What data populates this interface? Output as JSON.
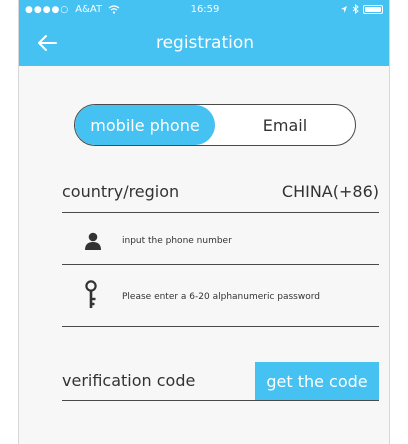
{
  "status_bar": {
    "signal_dots": "●●●●○",
    "carrier": "A&AT",
    "time": "16:59"
  },
  "nav": {
    "title": "registration"
  },
  "segment": {
    "active": "mobile phone",
    "inactive": "Email"
  },
  "country": {
    "label": "country/region",
    "value": "CHINA(+86)"
  },
  "phone": {
    "placeholder": "input the phone number"
  },
  "password": {
    "placeholder": "Please enter a 6-20 alphanumeric password"
  },
  "verification": {
    "label": "verification code",
    "button": "get the code"
  },
  "colors": {
    "accent": "#45c1f2",
    "line": "#4a4a4a",
    "background": "#f7f7f7"
  }
}
